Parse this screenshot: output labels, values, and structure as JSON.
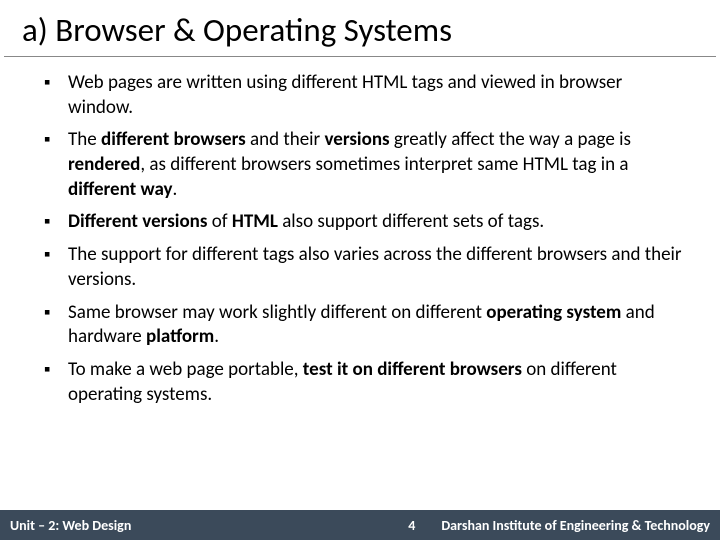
{
  "title": "a) Browser & Operating Systems",
  "bullets": [
    {
      "runs": [
        {
          "t": "Web pages are written using different HTML tags and viewed in browser window."
        }
      ]
    },
    {
      "runs": [
        {
          "t": "The "
        },
        {
          "t": "different browsers",
          "b": true
        },
        {
          "t": " and their "
        },
        {
          "t": "versions",
          "b": true
        },
        {
          "t": " greatly affect the way a page is "
        },
        {
          "t": "rendered",
          "b": true
        },
        {
          "t": ", as different browsers sometimes interpret same HTML tag in a "
        },
        {
          "t": "different way",
          "b": true
        },
        {
          "t": "."
        }
      ]
    },
    {
      "runs": [
        {
          "t": "Different versions",
          "b": true
        },
        {
          "t": " of "
        },
        {
          "t": "HTML",
          "b": true
        },
        {
          "t": " also support different sets of tags."
        }
      ]
    },
    {
      "runs": [
        {
          "t": "The support for different tags also varies across the different browsers and their versions."
        }
      ]
    },
    {
      "runs": [
        {
          "t": "Same browser may work slightly different on different "
        },
        {
          "t": "operating system",
          "b": true
        },
        {
          "t": " and hardware "
        },
        {
          "t": "platform",
          "b": true
        },
        {
          "t": "."
        }
      ]
    },
    {
      "runs": [
        {
          "t": "To make a web page portable, "
        },
        {
          "t": "test it on different browsers",
          "b": true
        },
        {
          "t": " on different operating systems."
        }
      ]
    }
  ],
  "footer": {
    "left": "Unit – 2: Web Design",
    "page": "4",
    "right": "Darshan Institute of Engineering & Technology"
  }
}
